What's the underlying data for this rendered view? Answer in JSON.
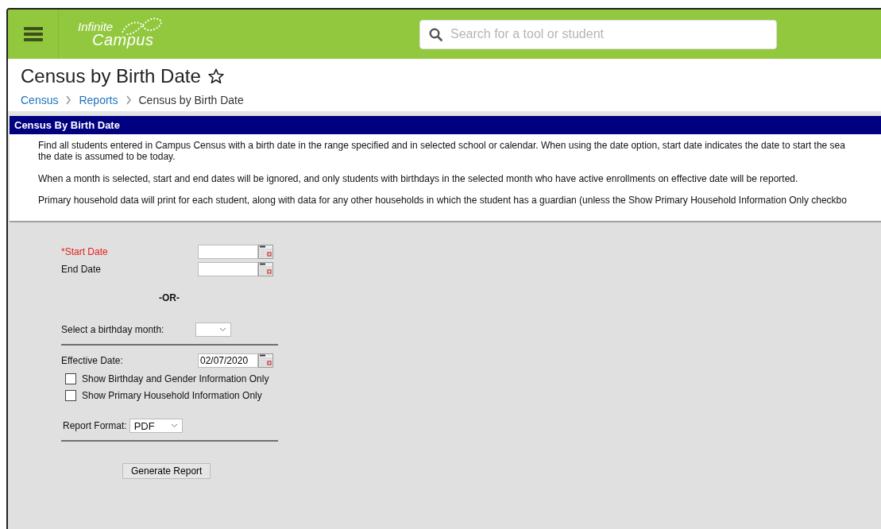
{
  "header": {
    "logo_top": "Infinite",
    "logo_bottom": "Campus",
    "search": {
      "placeholder": "Search for a tool or student"
    }
  },
  "page": {
    "title": "Census by Birth Date",
    "favorite": false,
    "breadcrumb": [
      {
        "label": "Census",
        "link": true
      },
      {
        "label": "Reports",
        "link": true
      },
      {
        "label": "Census by Birth Date",
        "link": false
      }
    ]
  },
  "panel": {
    "title": "Census By Birth Date",
    "paragraphs": [
      "Find all students entered in Campus Census with a birth date in the range specified and in selected school or calendar. When using the date option, start date indicates the date to start the sea\nthe date is assumed to be today.",
      "When a month is selected, start and end dates will be ignored, and only students with birthdays in the selected month who have active enrollments on effective date will be reported.",
      "Primary household data will print for each student, along with data for any other households in which the student has a guardian (unless the Show Primary Household Information Only checkbo"
    ]
  },
  "form": {
    "start_date": {
      "label": "*Start Date",
      "required": true
    },
    "end_date": {
      "label": "End Date",
      "required": false
    },
    "or_label": "-OR-",
    "month": {
      "label": "Select a birthday month:"
    },
    "effective_date": {
      "label": "Effective Date:",
      "value": "02/07/2020"
    },
    "checkboxes": [
      {
        "label": "Show Birthday and Gender Information Only",
        "checked": false
      },
      {
        "label": "Show Primary Household Information Only",
        "checked": false
      }
    ],
    "report_format": {
      "label": "Report Format:",
      "value": "PDF"
    },
    "button": "Generate Report"
  }
}
